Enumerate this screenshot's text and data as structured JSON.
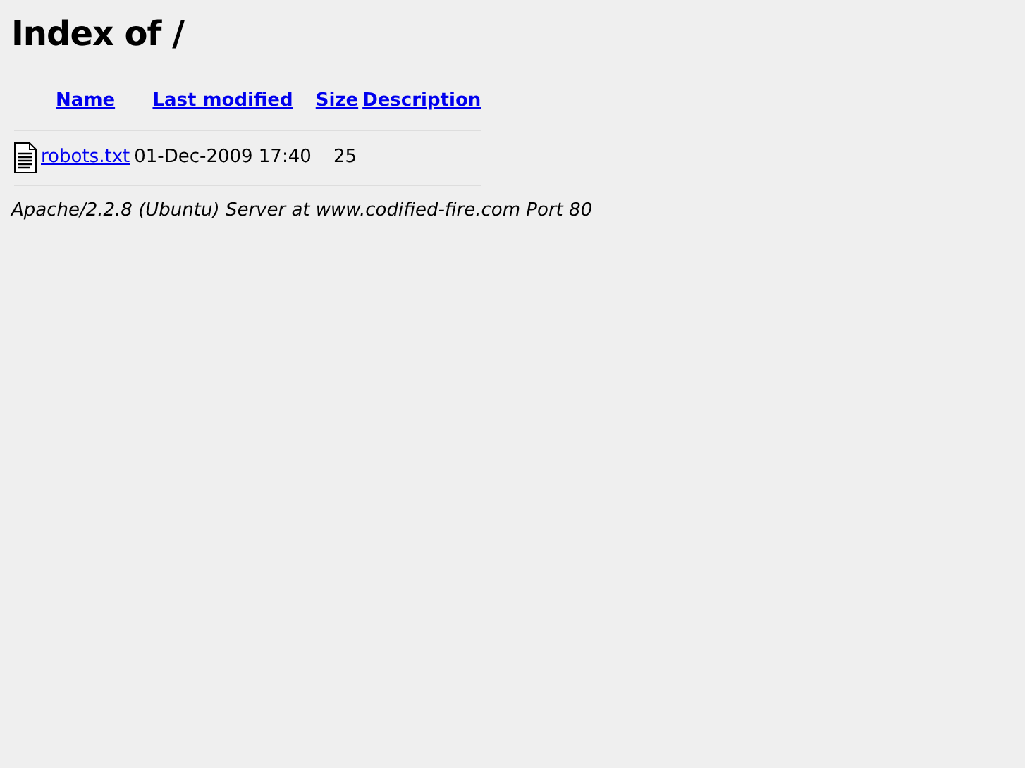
{
  "title": "Index of /",
  "table": {
    "columns": [
      "Name",
      "Last modified",
      "Size",
      "Description"
    ],
    "rows": [
      {
        "name": "robots.txt",
        "last_modified": "01-Dec-2009 17:40",
        "size": "25"
      }
    ]
  },
  "footer": "Apache/2.2.8 (Ubuntu) Server at www.codified-fire.com Port 80"
}
